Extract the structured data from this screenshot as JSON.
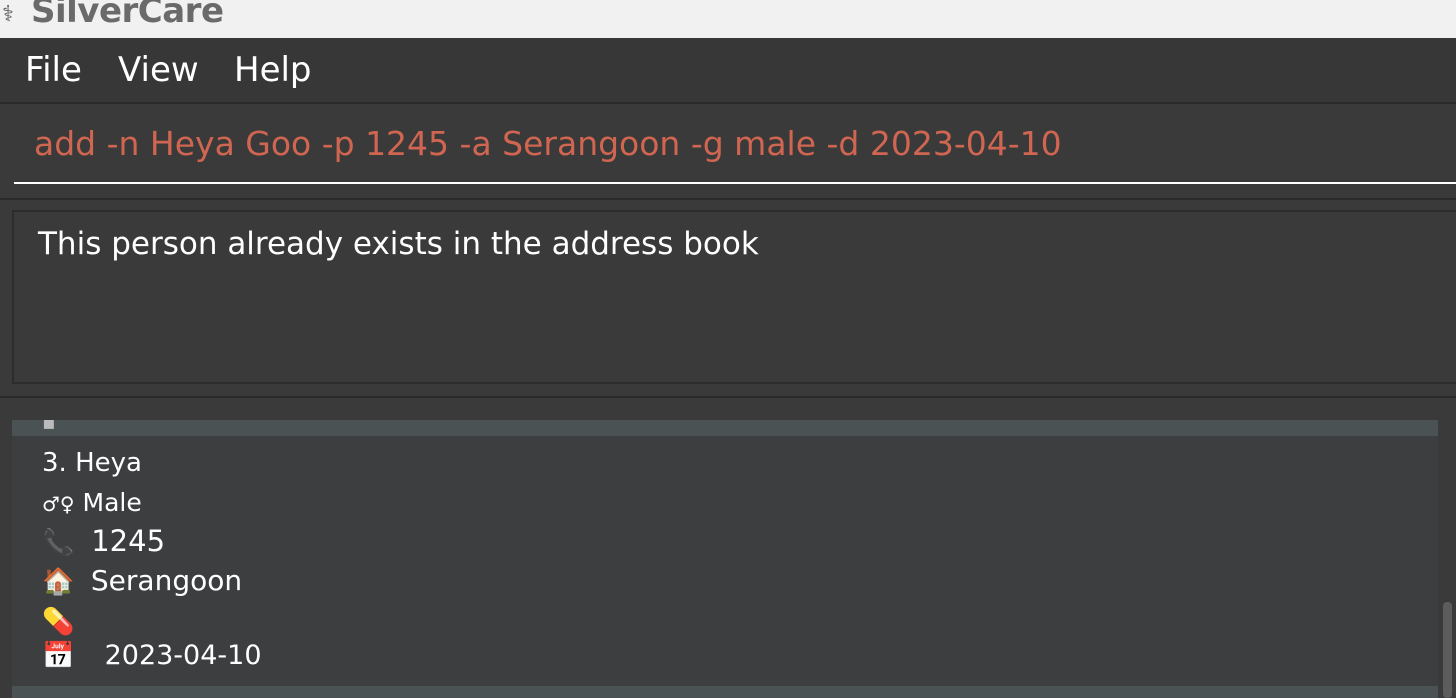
{
  "window": {
    "app_icon": "⚕",
    "title": "SilverCare"
  },
  "menu": {
    "items": [
      "File",
      "View",
      "Help"
    ]
  },
  "command": {
    "value": "add -n Heya Goo -p 1245 -a Serangoon -g male -d 2023-04-10"
  },
  "result": {
    "message": "This person already exists in the address book"
  },
  "person_list": {
    "cards": [
      {
        "index": "3.",
        "name": "Heya",
        "gender_icon": "♂♀",
        "gender": "Male",
        "phone_icon": "📞",
        "phone": "1245",
        "address_icon": "🏠",
        "address": "Serangoon",
        "medication_icon": "💊",
        "medication": "",
        "date_icon": "📅",
        "date": "2023-04-10"
      }
    ]
  }
}
